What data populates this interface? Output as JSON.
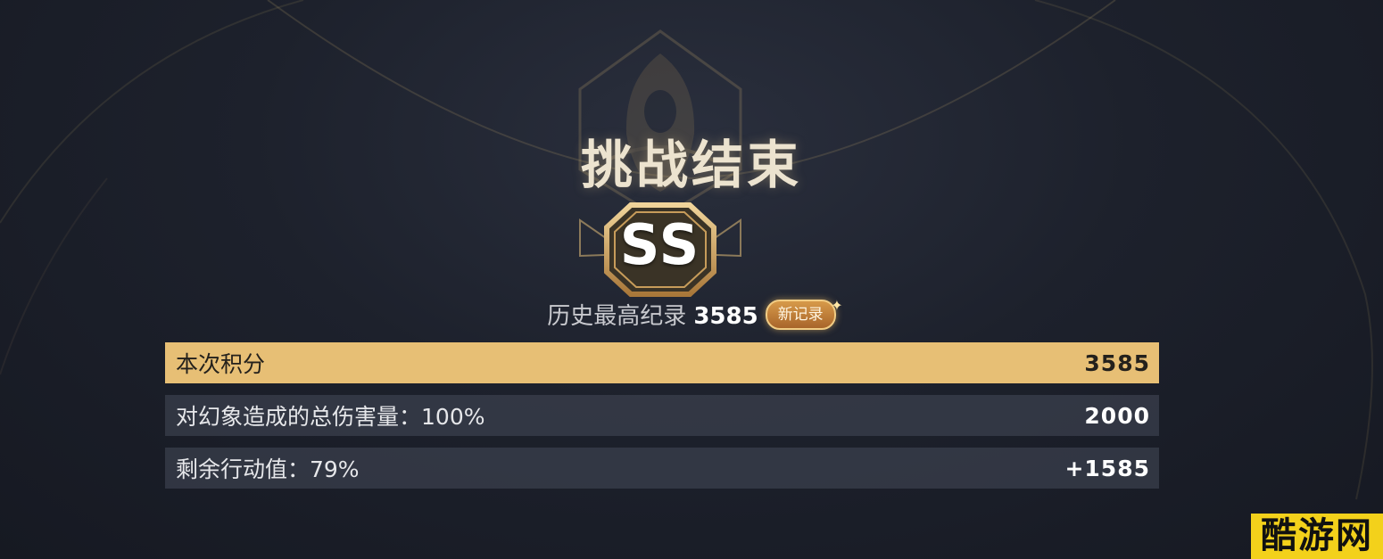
{
  "result": {
    "title": "挑战结束",
    "rank": "SS",
    "record_label": "历史最高纪录",
    "record_value": "3585",
    "new_record_badge": "新记录"
  },
  "score_rows": [
    {
      "label": "本次积分",
      "value": "3585"
    },
    {
      "label": "对幻象造成的总伤害量：100%",
      "value": "2000"
    },
    {
      "label": "剩余行动值：79%",
      "value": "+1585"
    }
  ],
  "watermark": "酷游网",
  "colors": {
    "background": "#1d212c",
    "gold_accent": "#e7bf75",
    "row_dark": "#3a3f4d",
    "title_text": "#ece3cf"
  },
  "icons": {
    "emblem": "hooded-figure-emblem-icon",
    "rank_frame": "octagon-rank-badge-icon",
    "sparkle": "sparkle-icon"
  }
}
